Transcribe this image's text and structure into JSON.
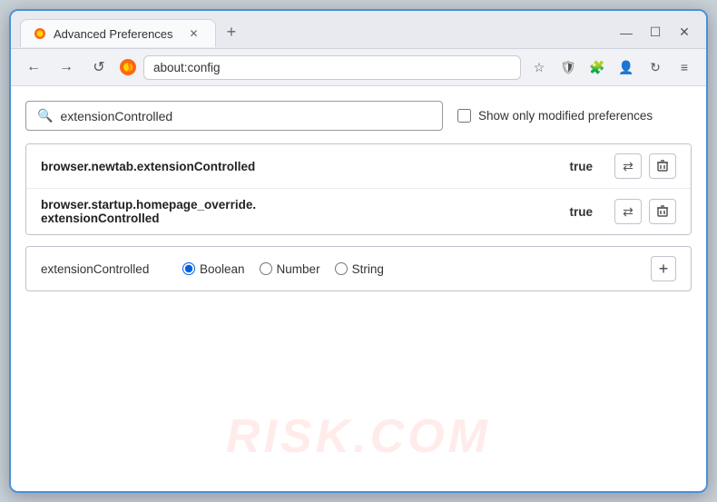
{
  "window": {
    "title": "Advanced Preferences",
    "url": "about:config",
    "browser_name": "Firefox"
  },
  "titlebar": {
    "tab_label": "Advanced Preferences",
    "new_tab_icon": "+",
    "minimize": "—",
    "maximize": "☐",
    "close": "✕"
  },
  "navbar": {
    "back_icon": "←",
    "forward_icon": "→",
    "reload_icon": "↺",
    "address": "about:config",
    "bookmark_icon": "☆",
    "shield_icon": "🛡",
    "extensions_icon": "🧩",
    "menu_icon": "≡"
  },
  "search": {
    "placeholder": "extensionControlled",
    "value": "extensionControlled",
    "checkbox_label": "Show only modified preferences"
  },
  "results": [
    {
      "name": "browser.newtab.extensionControlled",
      "value": "true"
    },
    {
      "name": "browser.startup.homepage_override.\nextensionControlled",
      "name_line1": "browser.startup.homepage_override.",
      "name_line2": "extensionControlled",
      "value": "true",
      "multiline": true
    }
  ],
  "new_pref": {
    "name": "extensionControlled",
    "types": [
      "Boolean",
      "Number",
      "String"
    ],
    "selected_type": "Boolean",
    "add_icon": "+"
  },
  "actions": {
    "reset_icon": "⇄",
    "delete_icon": "🗑"
  },
  "watermark": "RISK.COM"
}
